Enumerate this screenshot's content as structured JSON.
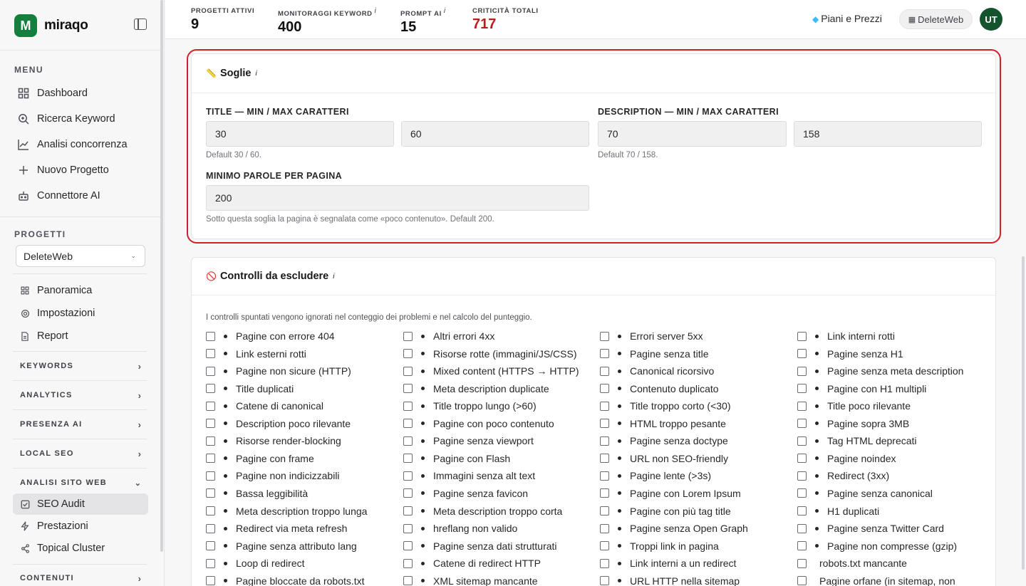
{
  "brand": {
    "logo_letter": "M",
    "name": "miraqo"
  },
  "sidebar": {
    "menu_title": "MENU",
    "menu": [
      {
        "label": "Dashboard",
        "icon": "grid-icon"
      },
      {
        "label": "Ricerca Keyword",
        "icon": "search-icon"
      },
      {
        "label": "Analisi concorrenza",
        "icon": "chart-line-icon"
      },
      {
        "label": "Nuovo Progetto",
        "icon": "plus-icon"
      },
      {
        "label": "Connettore AI",
        "icon": "robot-icon"
      }
    ],
    "projects_title": "PROGETTI",
    "project_selected": "DeleteWeb",
    "project_items": [
      {
        "label": "Panoramica",
        "icon": "grid-icon"
      },
      {
        "label": "Impostazioni",
        "icon": "gear-icon"
      },
      {
        "label": "Report",
        "icon": "document-icon"
      }
    ],
    "groups": [
      "KEYWORDS",
      "ANALYTICS",
      "PRESENZA AI",
      "LOCAL SEO",
      "ANALISI SITO WEB"
    ],
    "site_items": [
      {
        "label": "SEO Audit",
        "icon": "check-square-icon",
        "active": true
      },
      {
        "label": "Prestazioni",
        "icon": "bolt-icon"
      },
      {
        "label": "Topical Cluster",
        "icon": "share-icon"
      }
    ],
    "last_group": "CONTENUTI"
  },
  "topbar": {
    "stats": [
      {
        "label": "PROGETTI ATTIVI",
        "value": "9",
        "info": ""
      },
      {
        "label": "MONITORAGGI KEYWORD",
        "value": "400",
        "info": "i"
      },
      {
        "label": "PROMPT AI",
        "value": "15",
        "info": "i"
      },
      {
        "label": "CRITICITÀ TOTALI",
        "value": "717",
        "info": ""
      }
    ],
    "plans_label": "Piani e Prezzi",
    "workspace_label": "DeleteWeb",
    "avatar_initials": "UT",
    "critical_color": "#b91c1c"
  },
  "thresholds": {
    "title": "Soglie",
    "info": "i",
    "title_label": "TITLE — MIN / MAX CARATTERI",
    "title_min": "30",
    "title_max": "60",
    "title_hint": "Default 30 / 60.",
    "desc_label": "DESCRIPTION — MIN / MAX CARATTERI",
    "desc_min": "70",
    "desc_max": "158",
    "desc_hint": "Default 70 / 158.",
    "words_label": "MINIMO PAROLE PER PAGINA",
    "words_min": "200",
    "words_hint": "Sotto questa soglia la pagina è segnalata come «poco contenuto». Default 200."
  },
  "exclusions": {
    "title": "Controlli da escludere",
    "info": "i",
    "intro": "I controlli spuntati vengono ignorati nel conteggio dei problemi e nel calcolo del punteggio.",
    "items": [
      "Pagine con errore 404",
      "Altri errori 4xx",
      "Errori server 5xx",
      "Link interni rotti",
      "Link esterni rotti",
      "Risorse rotte (immagini/JS/CSS)",
      "Pagine senza title",
      "Pagine senza H1",
      "Pagine non sicure (HTTP)",
      "Mixed content (HTTPS → HTTP)",
      "Canonical ricorsivo",
      "Pagine senza meta description",
      "Title duplicati",
      "Meta description duplicate",
      "Contenuto duplicato",
      "Pagine con H1 multipli",
      "Catene di canonical",
      "Title troppo lungo (>60)",
      "Title troppo corto (<30)",
      "Title poco rilevante",
      "Description poco rilevante",
      "Pagine con poco contenuto",
      "HTML troppo pesante",
      "Pagine sopra 3MB",
      "Risorse render-blocking",
      "Pagine senza viewport",
      "Pagine senza doctype",
      "Tag HTML deprecati",
      "Pagine con frame",
      "Pagine con Flash",
      "URL non SEO-friendly",
      "Pagine noindex",
      "Pagine non indicizzabili",
      "Immagini senza alt text",
      "Pagine lente (>3s)",
      "Redirect (3xx)",
      "Bassa leggibilità",
      "Pagine senza favicon",
      "Pagine con Lorem Ipsum",
      "Pagine senza canonical",
      "Meta description troppo lunga",
      "Meta description troppo corta",
      "Pagine con più tag title",
      "H1 duplicati",
      "Redirect via meta refresh",
      "hreflang non valido",
      "Pagine senza Open Graph",
      "Pagine senza Twitter Card",
      "Pagine senza attributo lang",
      "Pagine senza dati strutturati",
      "Troppi link in pagina",
      "Pagine non compresse (gzip)",
      "Loop di redirect",
      "Catene di redirect HTTP",
      "Link interni a un redirect",
      "robots.txt mancante",
      "Pagine bloccate da robots.txt",
      "XML sitemap mancante",
      "URL HTTP nella sitemap",
      "Pagine orfane (in sitemap, non"
    ]
  }
}
